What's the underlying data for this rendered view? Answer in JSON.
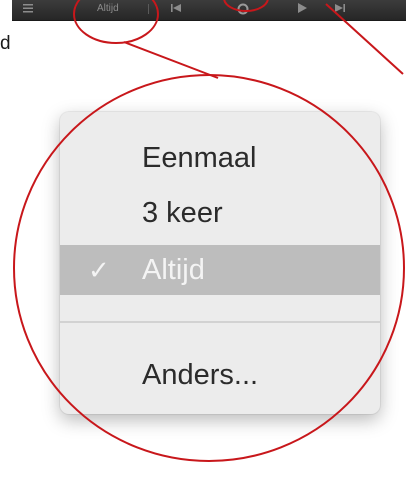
{
  "toolbar": {
    "mode_label": "Altijd"
  },
  "side_text": "d",
  "menu": {
    "items": [
      {
        "label": "Eenmaal",
        "selected": false
      },
      {
        "label": "3 keer",
        "selected": false
      },
      {
        "label": "Altijd",
        "selected": true,
        "check": "✓"
      },
      {
        "label": "Anders...",
        "selected": false
      }
    ]
  },
  "colors": {
    "annotation": "#c8171b",
    "selection": "#bdbdbd",
    "menu_background": "#ececec",
    "toolbar": "#2e2e2e"
  },
  "icons": [
    "list-icon",
    "skip-back-icon",
    "repeat-icon",
    "play-icon",
    "skip-forward-icon"
  ]
}
